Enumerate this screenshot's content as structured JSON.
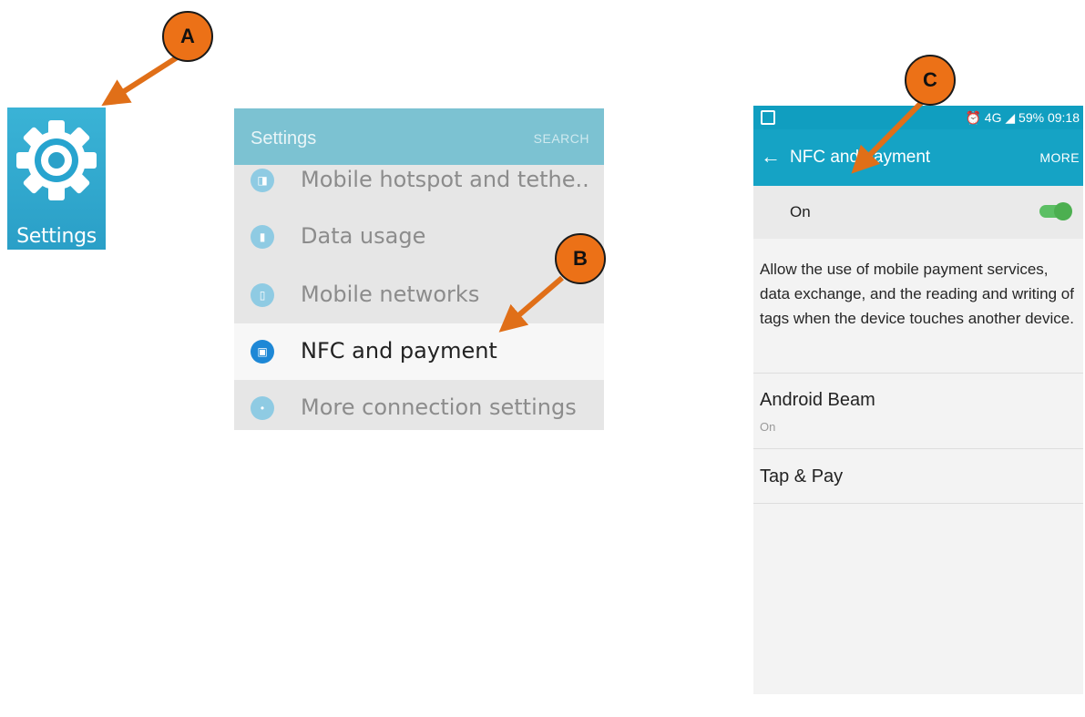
{
  "callouts": {
    "a": "A",
    "b": "B",
    "c": "C"
  },
  "colors": {
    "callout": "#ec7117",
    "arrow": "#e06f18",
    "settings_header": "#7cc2d2",
    "nfc_appbar": "#15a3c5",
    "toggle_on": "#4caf50"
  },
  "app_icon": {
    "label": "Settings",
    "icon": "gear-icon"
  },
  "settings_list": {
    "title": "Settings",
    "search": "SEARCH",
    "items": [
      {
        "label": "Mobile hotspot and tethe..",
        "icon": "hotspot-icon"
      },
      {
        "label": "Data usage",
        "icon": "data-usage-icon"
      },
      {
        "label": "Mobile networks",
        "icon": "mobile-networks-icon"
      },
      {
        "label": "NFC and payment",
        "icon": "nfc-icon",
        "selected": true
      },
      {
        "label": "More connection settings",
        "icon": "more-connections-icon"
      }
    ]
  },
  "nfc_screen": {
    "status_bar": "59% 09:18",
    "status_network": "4G",
    "back": "←",
    "title": "NFC and payment",
    "more": "MORE",
    "toggle_label": "On",
    "toggle_on": true,
    "description": "Allow the use of mobile payment services, data exchange, and the reading and writing of tags when the device touches another device.",
    "android_beam": {
      "title": "Android Beam",
      "subtitle": "On"
    },
    "tap_pay": {
      "title": "Tap & Pay"
    }
  }
}
